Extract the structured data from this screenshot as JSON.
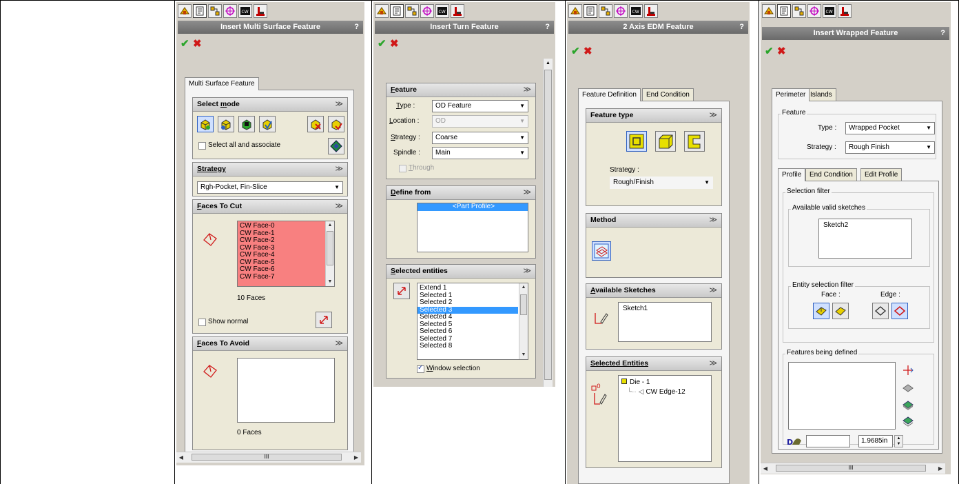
{
  "panel1": {
    "title": "Insert Multi Surface Feature",
    "help": "?",
    "ok": "✔",
    "cancel": "✖",
    "tab": "Multi Surface Feature",
    "select_mode": {
      "label_a": "Select ",
      "label_u": "m",
      "label_b": "ode",
      "checkbox": "Select all and associate"
    },
    "strategy": {
      "label": "Strategy",
      "value": "Rgh-Pocket, Fin-Slice"
    },
    "faces_to_cut": {
      "label_u": "F",
      "label_b": "aces To Cut",
      "items": [
        "CW Face-0",
        "CW Face-1",
        "CW Face-2",
        "CW Face-3",
        "CW Face-4",
        "CW Face-5",
        "CW Face-6",
        "CW Face-7"
      ],
      "count": "10 Faces",
      "show_normal": "Show normal"
    },
    "faces_to_avoid": {
      "label_u": "F",
      "label_b": "aces To Avoid",
      "count": "0 Faces"
    },
    "hscroll_grip": "III"
  },
  "panel2": {
    "title": "Insert Turn Feature",
    "help": "?",
    "ok": "✔",
    "cancel": "✖",
    "feature": {
      "label_u": "F",
      "label_b": "eature",
      "type_label_u": "T",
      "type_label_b": "ype :",
      "type_value": "OD Feature",
      "location_label_u": "L",
      "location_label_b": "ocation :",
      "location_value": "OD",
      "strategy_label_u": "S",
      "strategy_label_b": "trategy :",
      "strategy_value": "Coarse",
      "spindle_label": "Spindle :",
      "spindle_value": "Main",
      "through_u": "T",
      "through_b": "hrough"
    },
    "define_from": {
      "label_u": "D",
      "label_b": "efine from",
      "items": [
        "<Part Profile>"
      ]
    },
    "selected_entities": {
      "label_u": "S",
      "label_b": "elected entities",
      "items": [
        "Extend 1",
        "Selected 1",
        "Selected 2",
        "Selected 3",
        "Selected 4",
        "Selected 5",
        "Selected 6",
        "Selected 7",
        "Selected 8"
      ],
      "window_u": "W",
      "window_b": "indow selection"
    }
  },
  "panel3": {
    "title": "2 Axis EDM Feature",
    "help": "?",
    "ok": "✔",
    "cancel": "✖",
    "tabs": [
      "Feature Definition",
      "End Condition"
    ],
    "feature_type": {
      "label": "Feature type",
      "strategy_label": "Strategy :",
      "strategy_value": "Rough/Finish"
    },
    "method": {
      "label": "Method"
    },
    "available_sketches": {
      "label_u": "A",
      "label_b": "vailable Sketches",
      "items": [
        "Sketch1"
      ]
    },
    "selected_entities": {
      "label": "Selected Entities",
      "root": "Die - 1",
      "child": "CW Edge-12"
    }
  },
  "panel4": {
    "title": "Insert Wrapped Feature",
    "help": "?",
    "ok": "✔",
    "cancel": "✖",
    "tabs": [
      "Perimeter",
      "Islands"
    ],
    "feature_group": "Feature",
    "type_label": "Type :",
    "type_value": "Wrapped Pocket",
    "strategy_label": "Strategy :",
    "strategy_value": "Rough Finish",
    "subtabs": [
      "Profile",
      "End Condition",
      "Edit Profile"
    ],
    "selection_filter": "Selection filter",
    "available_valid": "Available valid sketches",
    "sketch_items": [
      "Sketch2"
    ],
    "entity_filter": "Entity selection filter",
    "face_label": "Face :",
    "edge_label": "Edge :",
    "features_defined": "Features being defined",
    "depth_value": "1.9685in",
    "hscroll_grip": "III"
  },
  "colors": {
    "panel_bg": "#d4d0c8",
    "title_bg": "#7a7a7a",
    "face_list_bg": "#f88080",
    "selection": "#3399ff"
  }
}
